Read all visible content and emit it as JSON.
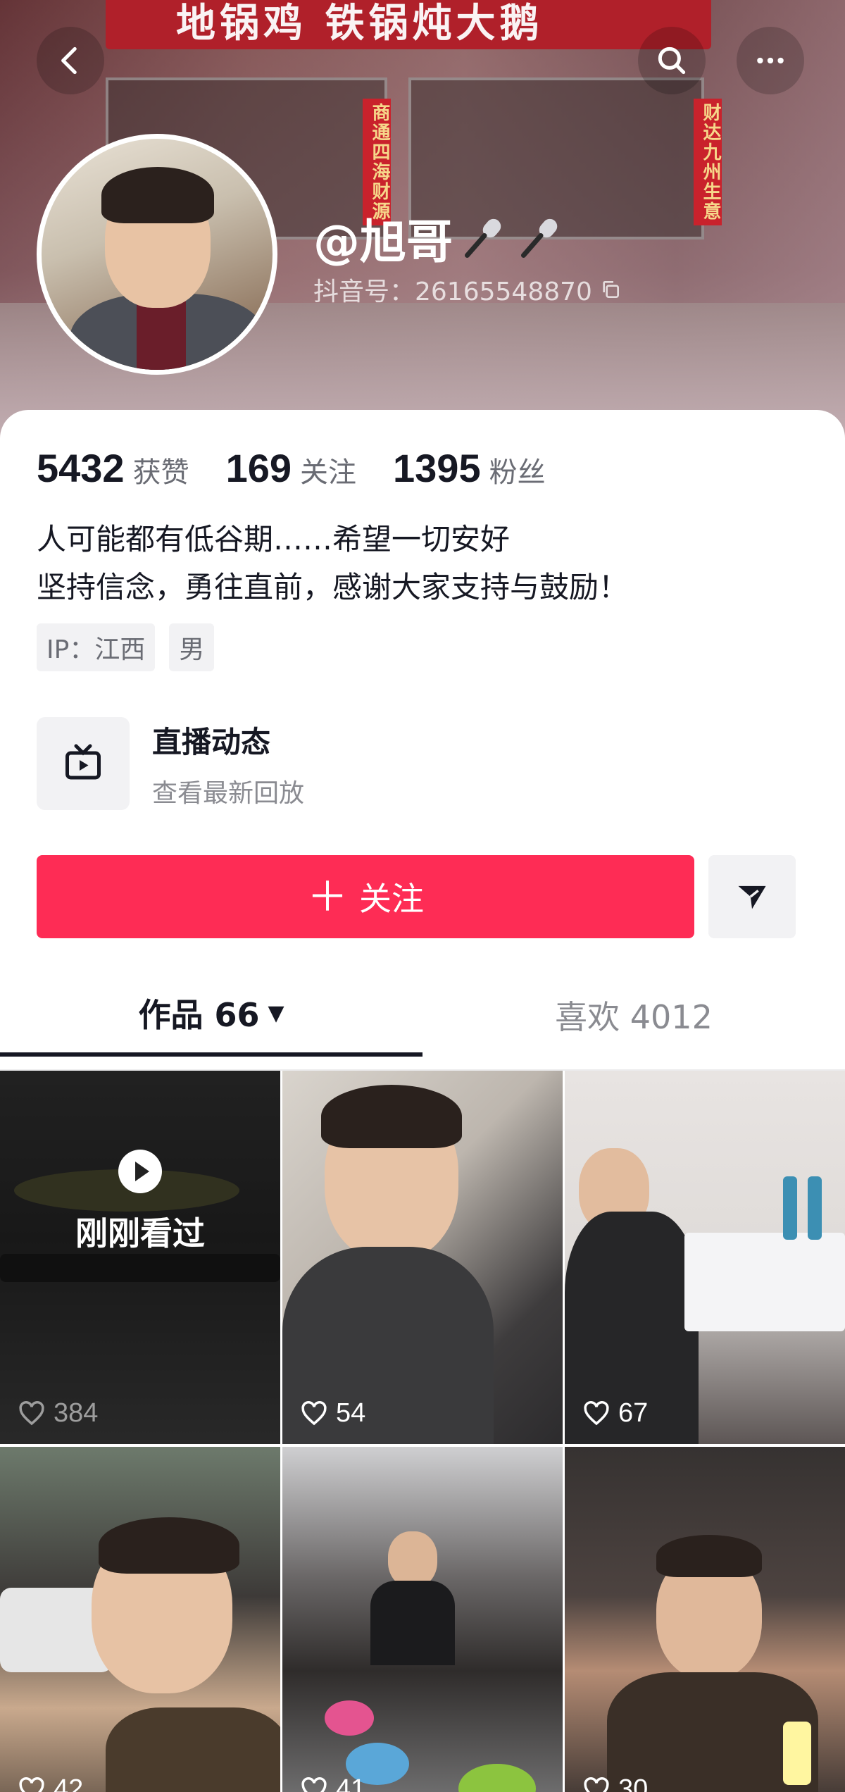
{
  "header": {
    "sign_text": "地锅鸡 铁锅炖大鹅",
    "couplet_left": "商通四海财源",
    "couplet_right": "财达九州生意",
    "username": "@旭哥",
    "douyin_id": "抖音号：26165548870"
  },
  "stats": [
    {
      "num": "5432",
      "label": "获赞"
    },
    {
      "num": "169",
      "label": "关注"
    },
    {
      "num": "1395",
      "label": "粉丝"
    }
  ],
  "bio": {
    "line1": "人可能都有低谷期……希望一切安好",
    "line2": "坚持信念，勇往直前，感谢大家支持与鼓励！"
  },
  "tags": [
    "IP：江西",
    "男"
  ],
  "live": {
    "title": "直播动态",
    "subtitle": "查看最新回放"
  },
  "actions": {
    "follow": "关注"
  },
  "tabs": {
    "works": "作品 66",
    "likes": "喜欢 4012"
  },
  "videos": [
    {
      "likes": "384",
      "badge": "刚刚看过"
    },
    {
      "likes": "54"
    },
    {
      "likes": "67"
    },
    {
      "likes": "42"
    },
    {
      "likes": "41"
    },
    {
      "likes": "30"
    }
  ],
  "colors": {
    "accent": "#fe2c55",
    "text": "#161823",
    "muted": "#8a8b91"
  }
}
